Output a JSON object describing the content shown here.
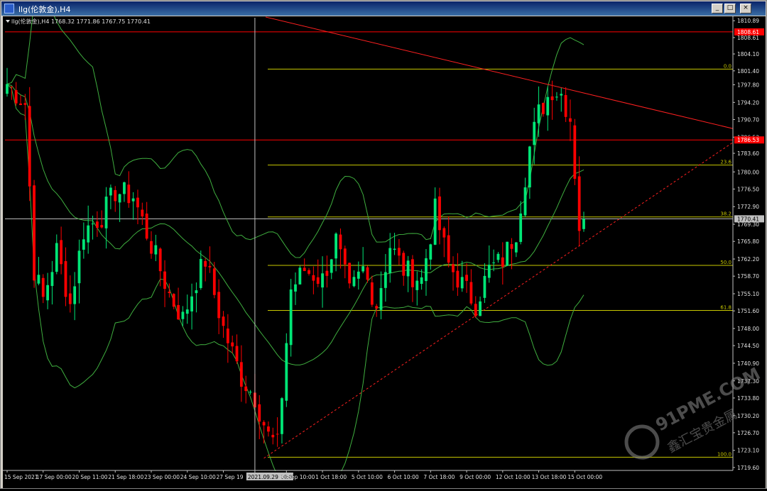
{
  "window": {
    "title": "llg(伦敦金),H4",
    "min_label": "_",
    "max_label": "□",
    "close_label": "×"
  },
  "chart_header": "llg(伦敦金),H4  1768.32 1771.86 1767.75 1770.41",
  "watermark": {
    "brand": "91PME.COM",
    "slogan": "鑫汇宝贵金属"
  },
  "colors": {
    "background": "#000000",
    "bull": "#00e676",
    "bear": "#ff0000",
    "band": "#3fae3f",
    "fib": "#c8c800",
    "resistance": "#ff0000",
    "trend": "#ff2020",
    "crosshair": "#c0c0c0"
  },
  "chart_data": {
    "type": "candlestick",
    "symbol": "llg(伦敦金)",
    "timeframe": "H4",
    "ohlc": {
      "open": 1768.32,
      "high": 1771.86,
      "low": 1767.75,
      "close": 1770.41
    },
    "current_price": 1770.41,
    "ylim": [
      1719.0,
      1811.5
    ],
    "y_ticks": [
      1810.89,
      1807.45,
      1804.1,
      1800.65,
      1797.8,
      1794.2,
      1790.7,
      1787.1,
      1783.8,
      1780.0,
      1776.5,
      1772.9,
      1769.3,
      1765.8,
      1762.2,
      1758.7,
      1755.1,
      1751.6,
      1748.0,
      1744.5,
      1740.9,
      1737.3,
      1733.8,
      1730.2,
      1726.7,
      1723.1,
      1719.6
    ],
    "y_tick_labels": [
      "1810.89",
      "1808.61",
      "1804.10",
      "1801.40",
      "1797.80",
      "1794.20",
      "1790.70",
      "1786.53",
      "1783.60",
      "1780.00",
      "1776.50",
      "1772.90",
      "1769.30",
      "1765.80",
      "1762.20",
      "1758.70",
      "1755.10",
      "1751.60",
      "1748.00",
      "1744.50",
      "1740.90",
      "1737.30",
      "1733.80",
      "1730.20",
      "1726.70",
      "1723.10",
      "1719.60"
    ],
    "price_tags": [
      {
        "label": "1808.61",
        "value": 1808.61,
        "color": "#ff0000"
      },
      {
        "label": "1786.53",
        "value": 1786.53,
        "color": "#ff0000"
      },
      {
        "label": "1770.41",
        "value": 1770.41,
        "color": "#c0c0c0"
      }
    ],
    "x_labels": [
      "15 Sep 2021",
      "17 Sep 00:00",
      "20 Sep 11:00",
      "21 Sep 18:00",
      "23 Sep 00:00",
      "24 Sep 10:00",
      "27 Sep 19",
      "2021.09.29 10:00",
      "30 Sep 10:00",
      "1 Oct 18:00",
      "5 Oct 10:00",
      "6 Oct 10:00",
      "7 Oct 18:00",
      "9 Oct 00:00",
      "12 Oct 10:00",
      "13 Oct 18:00",
      "15 Oct 00:00"
    ],
    "x_label_index": [
      0,
      8,
      16,
      24,
      32,
      40,
      48,
      55,
      62,
      70,
      78,
      86,
      94,
      102,
      110,
      118,
      126
    ],
    "fib_levels": [
      {
        "label": "0.0",
        "value": 1801.0
      },
      {
        "label": "23.6",
        "value": 1781.4
      },
      {
        "label": "38.2",
        "value": 1770.8
      },
      {
        "label": "50.0",
        "value": 1760.9
      },
      {
        "label": "61.8",
        "value": 1751.7
      },
      {
        "label": "100.0",
        "value": 1721.7
      }
    ],
    "horizontal_lines": [
      1808.61,
      1786.53,
      1770.41
    ],
    "crosshair_index": 55,
    "candle_count": 129,
    "anchors": [
      [
        0,
        1798
      ],
      [
        4,
        1794
      ],
      [
        6,
        1760
      ],
      [
        8,
        1754
      ],
      [
        11,
        1764
      ],
      [
        14,
        1753
      ],
      [
        17,
        1768
      ],
      [
        21,
        1771
      ],
      [
        24,
        1776
      ],
      [
        28,
        1775
      ],
      [
        32,
        1765
      ],
      [
        36,
        1755
      ],
      [
        39,
        1750
      ],
      [
        42,
        1758
      ],
      [
        44,
        1762
      ],
      [
        48,
        1748
      ],
      [
        52,
        1738
      ],
      [
        55,
        1734
      ],
      [
        58,
        1726
      ],
      [
        60,
        1724
      ],
      [
        63,
        1756
      ],
      [
        66,
        1760
      ],
      [
        70,
        1758
      ],
      [
        73,
        1766
      ],
      [
        76,
        1755
      ],
      [
        79,
        1760
      ],
      [
        82,
        1753
      ],
      [
        85,
        1765
      ],
      [
        88,
        1760
      ],
      [
        92,
        1758
      ],
      [
        95,
        1772
      ],
      [
        98,
        1761
      ],
      [
        101,
        1757
      ],
      [
        104,
        1753
      ],
      [
        107,
        1760
      ],
      [
        110,
        1762
      ],
      [
        113,
        1768
      ],
      [
        116,
        1785
      ],
      [
        118,
        1792
      ],
      [
        121,
        1797
      ],
      [
        123,
        1796
      ],
      [
        125,
        1791
      ],
      [
        127,
        1769
      ],
      [
        128,
        1770.41
      ]
    ],
    "volatility": 2.6
  }
}
